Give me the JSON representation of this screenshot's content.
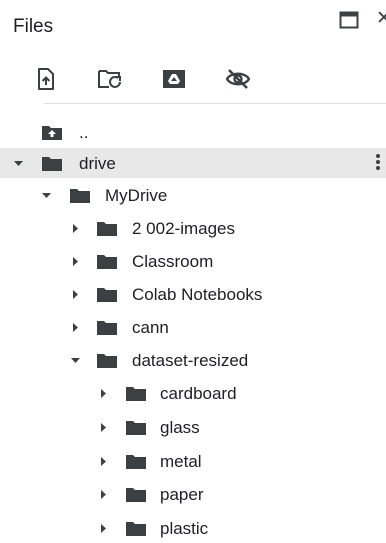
{
  "panel": {
    "title": "Files"
  },
  "toolbar": {
    "upload_icon": "upload-file-icon",
    "refresh_icon": "refresh-folder-icon",
    "drive_icon": "mount-drive-icon",
    "hidden_icon": "visibility-off-icon"
  },
  "tree": {
    "parent_label": "..",
    "drive_label": "drive",
    "mydrive_label": "MyDrive",
    "mydrive_children": [
      "2 002-images",
      "Classroom",
      "Colab Notebooks",
      "cann",
      "dataset-resized"
    ],
    "dataset_children": [
      "cardboard",
      "glass",
      "metal",
      "paper",
      "plastic"
    ]
  },
  "colors": {
    "icon": "#3c4043",
    "folder": "#3c4043",
    "selected_row": "#e8e8e8"
  }
}
